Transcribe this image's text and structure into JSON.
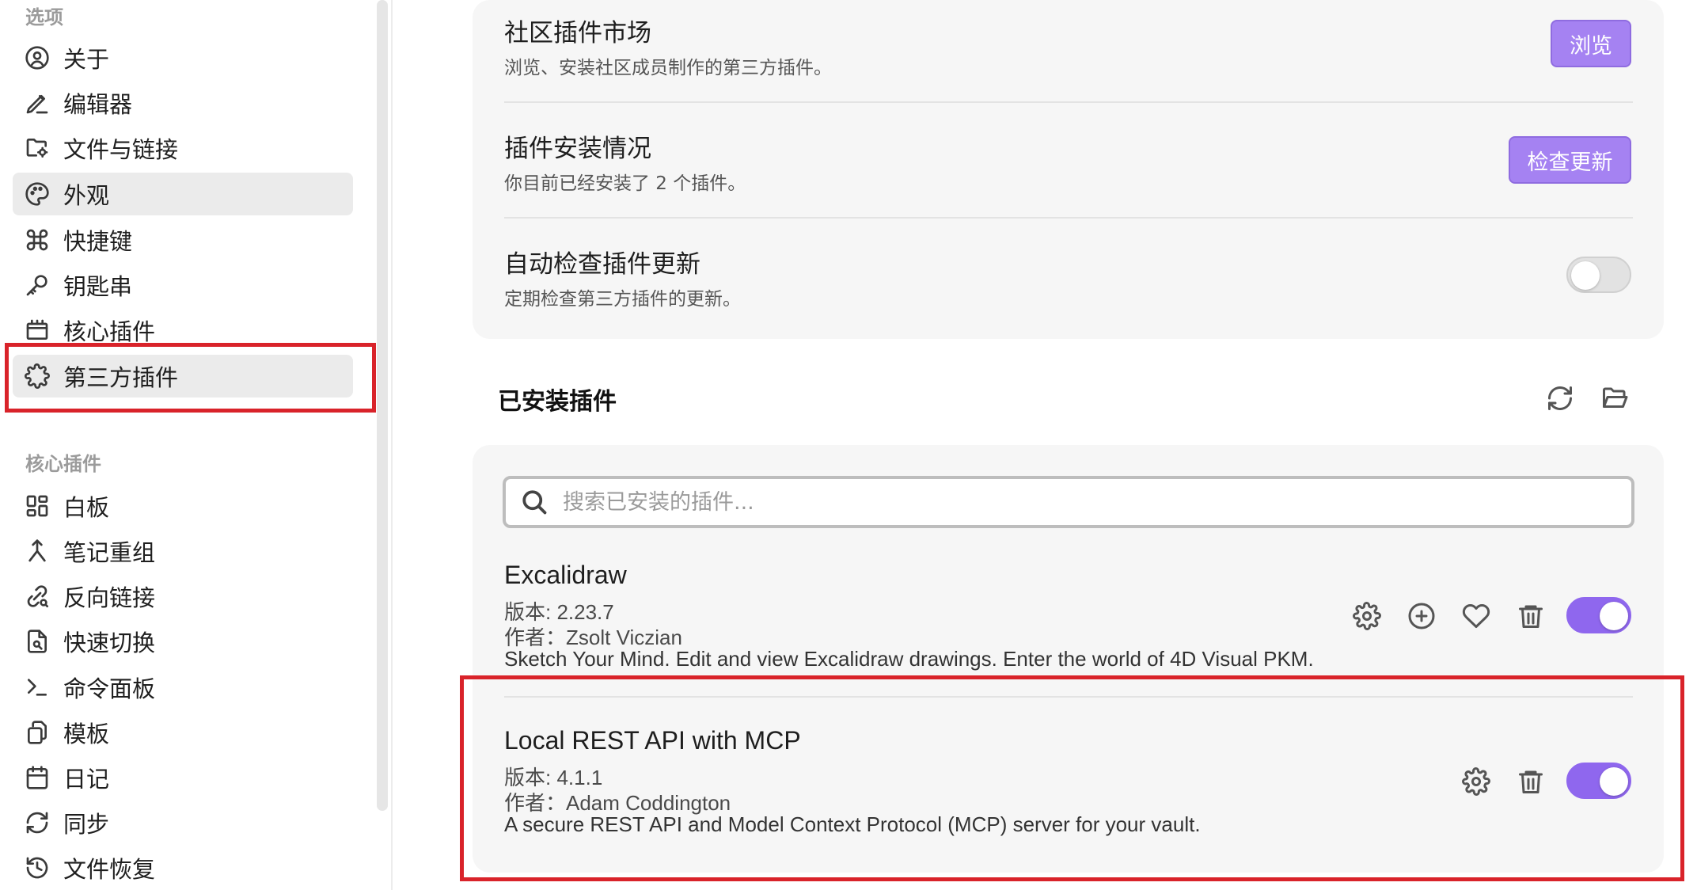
{
  "sidebar": {
    "options_title": "选项",
    "options_items": [
      {
        "label": "关于",
        "icon": "user-circle-icon"
      },
      {
        "label": "编辑器",
        "icon": "pen-icon"
      },
      {
        "label": "文件与链接",
        "icon": "folder-cog-icon"
      },
      {
        "label": "外观",
        "icon": "palette-icon",
        "active": true
      },
      {
        "label": "快捷键",
        "icon": "command-icon"
      },
      {
        "label": "钥匙串",
        "icon": "key-icon"
      },
      {
        "label": "核心插件",
        "icon": "calendar-box-icon"
      },
      {
        "label": "第三方插件",
        "icon": "puzzle-icon",
        "active": true
      }
    ],
    "core_title": "核心插件",
    "core_items": [
      {
        "label": "白板",
        "icon": "grid-icon"
      },
      {
        "label": "笔记重组",
        "icon": "merge-icon"
      },
      {
        "label": "反向链接",
        "icon": "link-search-icon"
      },
      {
        "label": "快速切换",
        "icon": "file-search-icon"
      },
      {
        "label": "命令面板",
        "icon": "terminal-icon"
      },
      {
        "label": "模板",
        "icon": "copy-icon"
      },
      {
        "label": "日记",
        "icon": "calendar-icon"
      },
      {
        "label": "同步",
        "icon": "sync-icon"
      },
      {
        "label": "文件恢复",
        "icon": "history-icon"
      }
    ]
  },
  "settings": {
    "community": {
      "title": "社区插件市场",
      "desc": "浏览、安装社区成员制作的第三方插件。",
      "button": "浏览"
    },
    "status": {
      "title": "插件安装情况",
      "desc": "你目前已经安装了 2 个插件。",
      "button": "检查更新"
    },
    "auto_update": {
      "title": "自动检查插件更新",
      "desc": "定期检查第三方插件的更新。",
      "enabled": false
    }
  },
  "installed": {
    "heading": "已安装插件",
    "search_placeholder": "搜索已安装的插件...",
    "plugins": [
      {
        "name": "Excalidraw",
        "version": "版本: 2.23.7",
        "author": "作者：Zsolt Viczian",
        "desc": "Sketch Your Mind. Edit and view Excalidraw drawings. Enter the world of 4D Visual PKM.",
        "enabled": true
      },
      {
        "name": "Local REST API with MCP",
        "version": "版本: 4.1.1",
        "author": "作者：Adam Coddington",
        "desc": "A secure REST API and Model Context Protocol (MCP) server for your vault.",
        "enabled": true
      }
    ]
  },
  "colors": {
    "accent": "#a582f2",
    "toggle_on": "#8f67ee",
    "highlight": "#d9232a"
  }
}
